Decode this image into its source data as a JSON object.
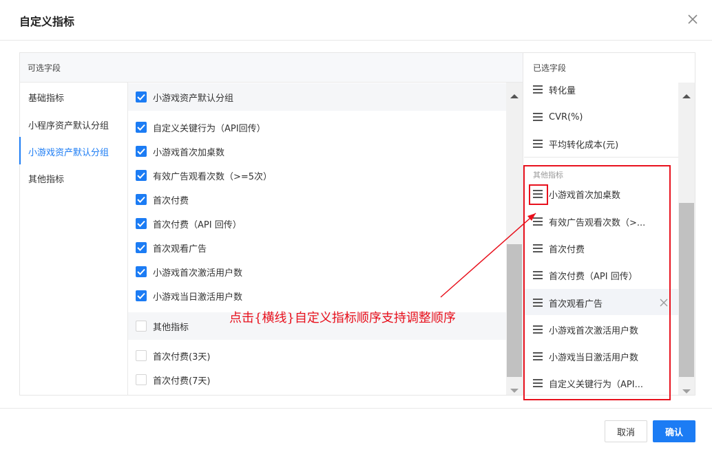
{
  "dialog": {
    "title": "自定义指标",
    "close_icon": "close-icon"
  },
  "available": {
    "header": "可选字段",
    "categories": [
      "基础指标",
      "小程序资产默认分组",
      "小游戏资产默认分组",
      "其他指标"
    ],
    "active_category": "小游戏资产默认分组",
    "group1": {
      "label": "小游戏资产默认分组",
      "checked": true,
      "items": [
        {
          "label": "自定义关键行为（API回传）",
          "checked": true
        },
        {
          "label": "小游戏首次加桌数",
          "checked": true
        },
        {
          "label": "有效广告观看次数（>=5次）",
          "checked": true
        },
        {
          "label": "首次付费",
          "checked": true
        },
        {
          "label": "首次付费（API 回传）",
          "checked": true
        },
        {
          "label": "首次观看广告",
          "checked": true
        },
        {
          "label": "小游戏首次激活用户数",
          "checked": true
        },
        {
          "label": "小游戏当日激活用户数",
          "checked": true
        }
      ]
    },
    "group2": {
      "label": "其他指标",
      "checked": false,
      "items": [
        {
          "label": "首次付费(3天)",
          "checked": false
        },
        {
          "label": "首次付费(7天)",
          "checked": false
        }
      ]
    }
  },
  "selected": {
    "header": "已选字段",
    "top_items": [
      "转化量",
      "CVR(%)",
      "平均转化成本(元)"
    ],
    "group_label": "其他指标",
    "group_items": [
      "小游戏首次加桌数",
      "有效广告观看次数（>...",
      "首次付费",
      "首次付费（API 回传）",
      "首次观看广告",
      "小游戏首次激活用户数",
      "小游戏当日激活用户数",
      "自定义关键行为（API..."
    ],
    "hovered_item": "首次观看广告"
  },
  "annotation": {
    "text": "点击{横线}自定义指标顺序支持调整顺序",
    "color": "#e8101c"
  },
  "footer": {
    "cancel_label": "取消",
    "ok_label": "确认"
  },
  "colors": {
    "accent": "#1c7cf4",
    "annotation_red": "#e8101c"
  }
}
